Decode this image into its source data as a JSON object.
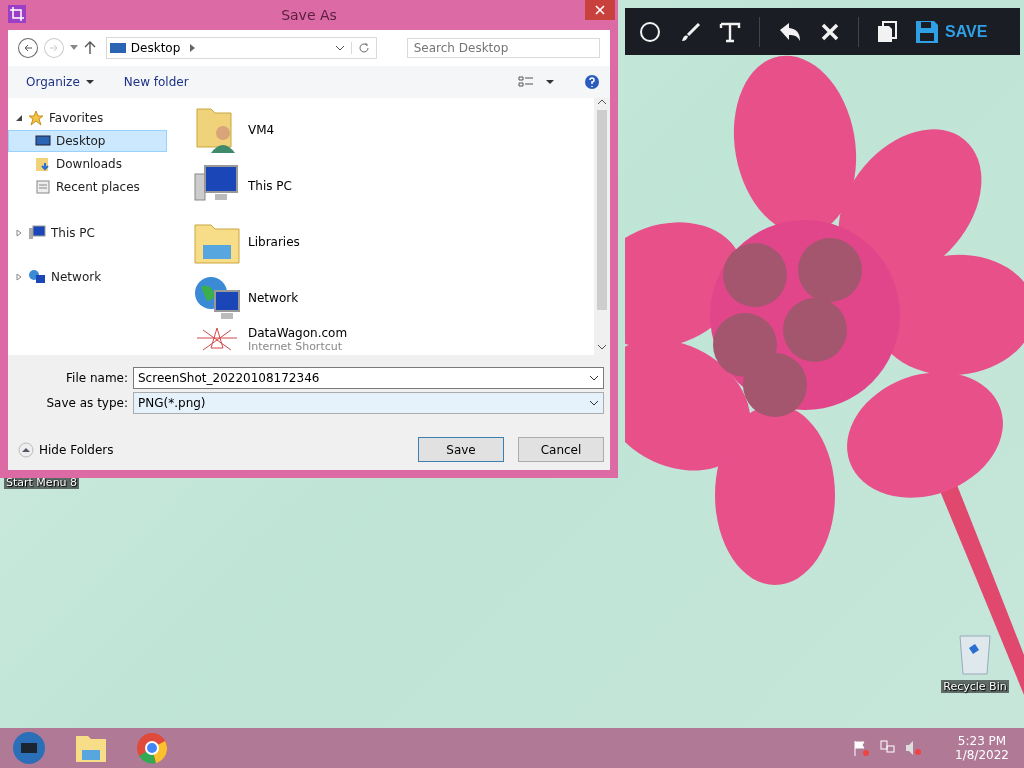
{
  "dialog": {
    "title": "Save As",
    "address": "Desktop",
    "search": {
      "placeholder": "Search Desktop"
    },
    "commands": [
      "Organize",
      "New folder"
    ],
    "nav": [
      {
        "label": "Favorites",
        "kind": "star",
        "expanded": true,
        "children": [
          {
            "label": "Desktop",
            "kind": "desktop",
            "selected": true
          },
          {
            "label": "Downloads",
            "kind": "downloads",
            "selected": false
          },
          {
            "label": "Recent places",
            "kind": "recent",
            "selected": false
          }
        ]
      },
      {
        "label": "This PC",
        "kind": "computer",
        "expanded": false
      },
      {
        "label": "Network",
        "kind": "network",
        "expanded": false
      }
    ],
    "files": [
      {
        "name": "VM4",
        "kind": "user-folder"
      },
      {
        "name": "This PC",
        "kind": "computer"
      },
      {
        "name": "Libraries",
        "kind": "libraries"
      },
      {
        "name": "Network",
        "kind": "network"
      },
      {
        "name": "DataWagon.com",
        "subtitle": "Internet Shortcut",
        "kind": "shortcut"
      }
    ],
    "file_name": {
      "label": "File name:",
      "value": "ScreenShot_20220108172346"
    },
    "save_as_type": {
      "label": "Save as type:",
      "value": "PNG(*.png)"
    },
    "hide_folders": "Hide Folders",
    "buttons": [
      {
        "label": "Save",
        "default": true
      },
      {
        "label": "Cancel",
        "default": false
      }
    ]
  },
  "capture_toolbar": {
    "tools": [
      {
        "kind": "circle"
      },
      {
        "kind": "brush"
      },
      {
        "kind": "text"
      },
      {
        "kind": "separator"
      },
      {
        "kind": "undo"
      },
      {
        "kind": "close"
      },
      {
        "kind": "separator"
      },
      {
        "kind": "copy"
      },
      {
        "kind": "save",
        "label": "SAVE"
      }
    ]
  },
  "desktop_icons": [
    {
      "label": "Start Menu 8",
      "kind": "label-only"
    },
    {
      "label": "Recycle Bin",
      "kind": "recycle-bin"
    }
  ],
  "taskbar": {
    "apps": [
      {
        "kind": "start"
      },
      {
        "kind": "explorer"
      },
      {
        "kind": "chrome"
      }
    ],
    "tray": [
      {
        "kind": "flag"
      },
      {
        "kind": "network"
      },
      {
        "kind": "volume"
      }
    ],
    "time": "5:23 PM",
    "date": "1/8/2022"
  }
}
